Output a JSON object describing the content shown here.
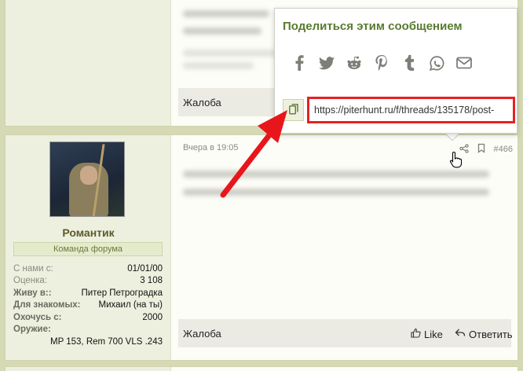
{
  "posts": {
    "top": {
      "report_label": "Жалоба"
    },
    "main": {
      "user": {
        "name": "Романтик",
        "title": "Команда форума",
        "stats": [
          {
            "key": "С нами с:",
            "value": "01/01/00",
            "bold": false
          },
          {
            "key": "Оценка:",
            "value": "3 108",
            "bold": false
          },
          {
            "key": "Живу в::",
            "value": "Питер Петроградка",
            "bold": true
          },
          {
            "key": "Для знакомых:",
            "value": "Михаил (на ты)",
            "bold": true
          },
          {
            "key": "Охочусь с:",
            "value": "2000",
            "bold": true
          }
        ],
        "weapon_key": "Оружие:",
        "weapon_value": "MP 153, Rem 700 VLS .243"
      },
      "date": "Вчера в 19:05",
      "post_number": "#466",
      "report_label": "Жалоба",
      "like_label": "Like",
      "reply_label": "Ответить"
    }
  },
  "share_popup": {
    "title": "Поделиться этим сообщением",
    "networks": [
      "facebook-icon",
      "twitter-icon",
      "reddit-icon",
      "pinterest-icon",
      "tumblr-icon",
      "whatsapp-icon",
      "email-icon"
    ],
    "url": "https://piterhunt.ru/f/threads/135178/post-"
  },
  "colors": {
    "accent_green": "#5a7a2e",
    "highlight_red": "#e52222",
    "page_bg": "#d5dab4"
  }
}
